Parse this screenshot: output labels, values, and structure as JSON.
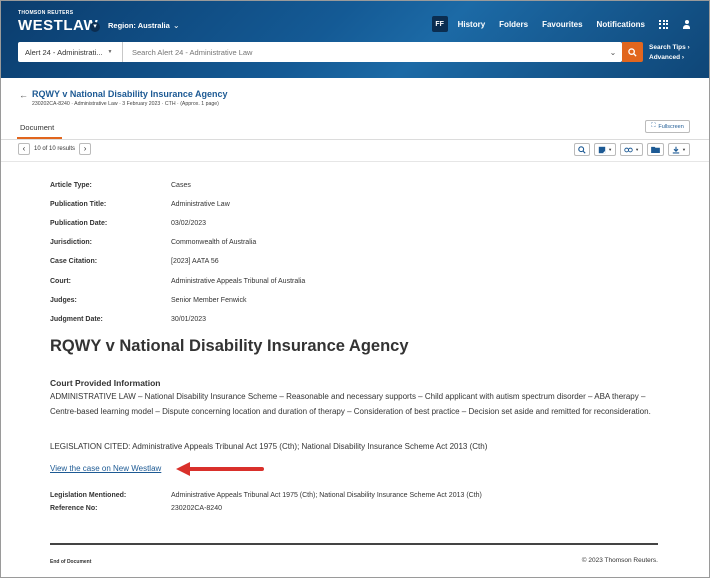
{
  "header": {
    "brand_sub": "THOMSON REUTERS",
    "brand_main": "WESTLAW",
    "region": "Region: Australia",
    "initials": "FF",
    "nav": [
      "History",
      "Folders",
      "Favourites",
      "Notifications"
    ],
    "icons": [
      "apps-grid-icon",
      "user-icon"
    ],
    "colors": {
      "header_bg": "#145a95",
      "accent": "#e1661e",
      "link": "#1d5a94"
    }
  },
  "search": {
    "scope": "Alert 24 - Administrati...",
    "placeholder": "Search Alert 24 - Administrative Law",
    "tips": "Search Tips",
    "advanced": "Advanced"
  },
  "document": {
    "title": "RQWY v National Disability Insurance Agency",
    "meta_line": "230202CA-8240  ·  Administrative Law  ·  3 February 2023  ·  CTH  ·  (Approx. 1 page)",
    "tab": "Document",
    "fullscreen": "Fullscreen",
    "pager": "10 of 10 results"
  },
  "metadata": [
    {
      "label": "Article Type:",
      "value": "Cases"
    },
    {
      "label": "Publication Title:",
      "value": "Administrative Law"
    },
    {
      "label": "Publication Date:",
      "value": "03/02/2023"
    },
    {
      "label": "Jurisdiction:",
      "value": "Commonwealth of Australia"
    },
    {
      "label": "Case Citation:",
      "value": "[2023] AATA 56"
    },
    {
      "label": "Court:",
      "value": "Administrative Appeals Tribunal of Australia"
    },
    {
      "label": "Judges:",
      "value": "Senior Member Fenwick"
    },
    {
      "label": "Judgment Date:",
      "value": "30/01/2023"
    }
  ],
  "body": {
    "case_title": "RQWY v National Disability Insurance Agency",
    "cpi_heading": "Court Provided Information",
    "summary": "ADMINISTRATIVE LAW – National Disability Insurance Scheme – Reasonable and necessary supports – Child applicant with autism spectrum disorder – ABA therapy – Centre-based learning model – Dispute concerning location and duration of therapy – Consideration of best practice – Decision set aside and remitted for reconsideration.",
    "legislation_cited": "LEGISLATION CITED: Administrative Appeals Tribunal Act 1975 (Cth); National Disability Insurance Scheme Act 2013 (Cth)",
    "new_westlaw_link": "View the case on New Westlaw",
    "arrow_color": "#d9302b"
  },
  "footer_meta": [
    {
      "label": "Legislation Mentioned:",
      "value": "Administrative Appeals Tribunal Act 1975 (Cth); National Disability Insurance Scheme Act 2013 (Cth)"
    },
    {
      "label": "Reference No:",
      "value": "230202CA-8240"
    }
  ],
  "footer": {
    "end": "End of Document",
    "copyright": "© 2023 Thomson Reuters."
  }
}
